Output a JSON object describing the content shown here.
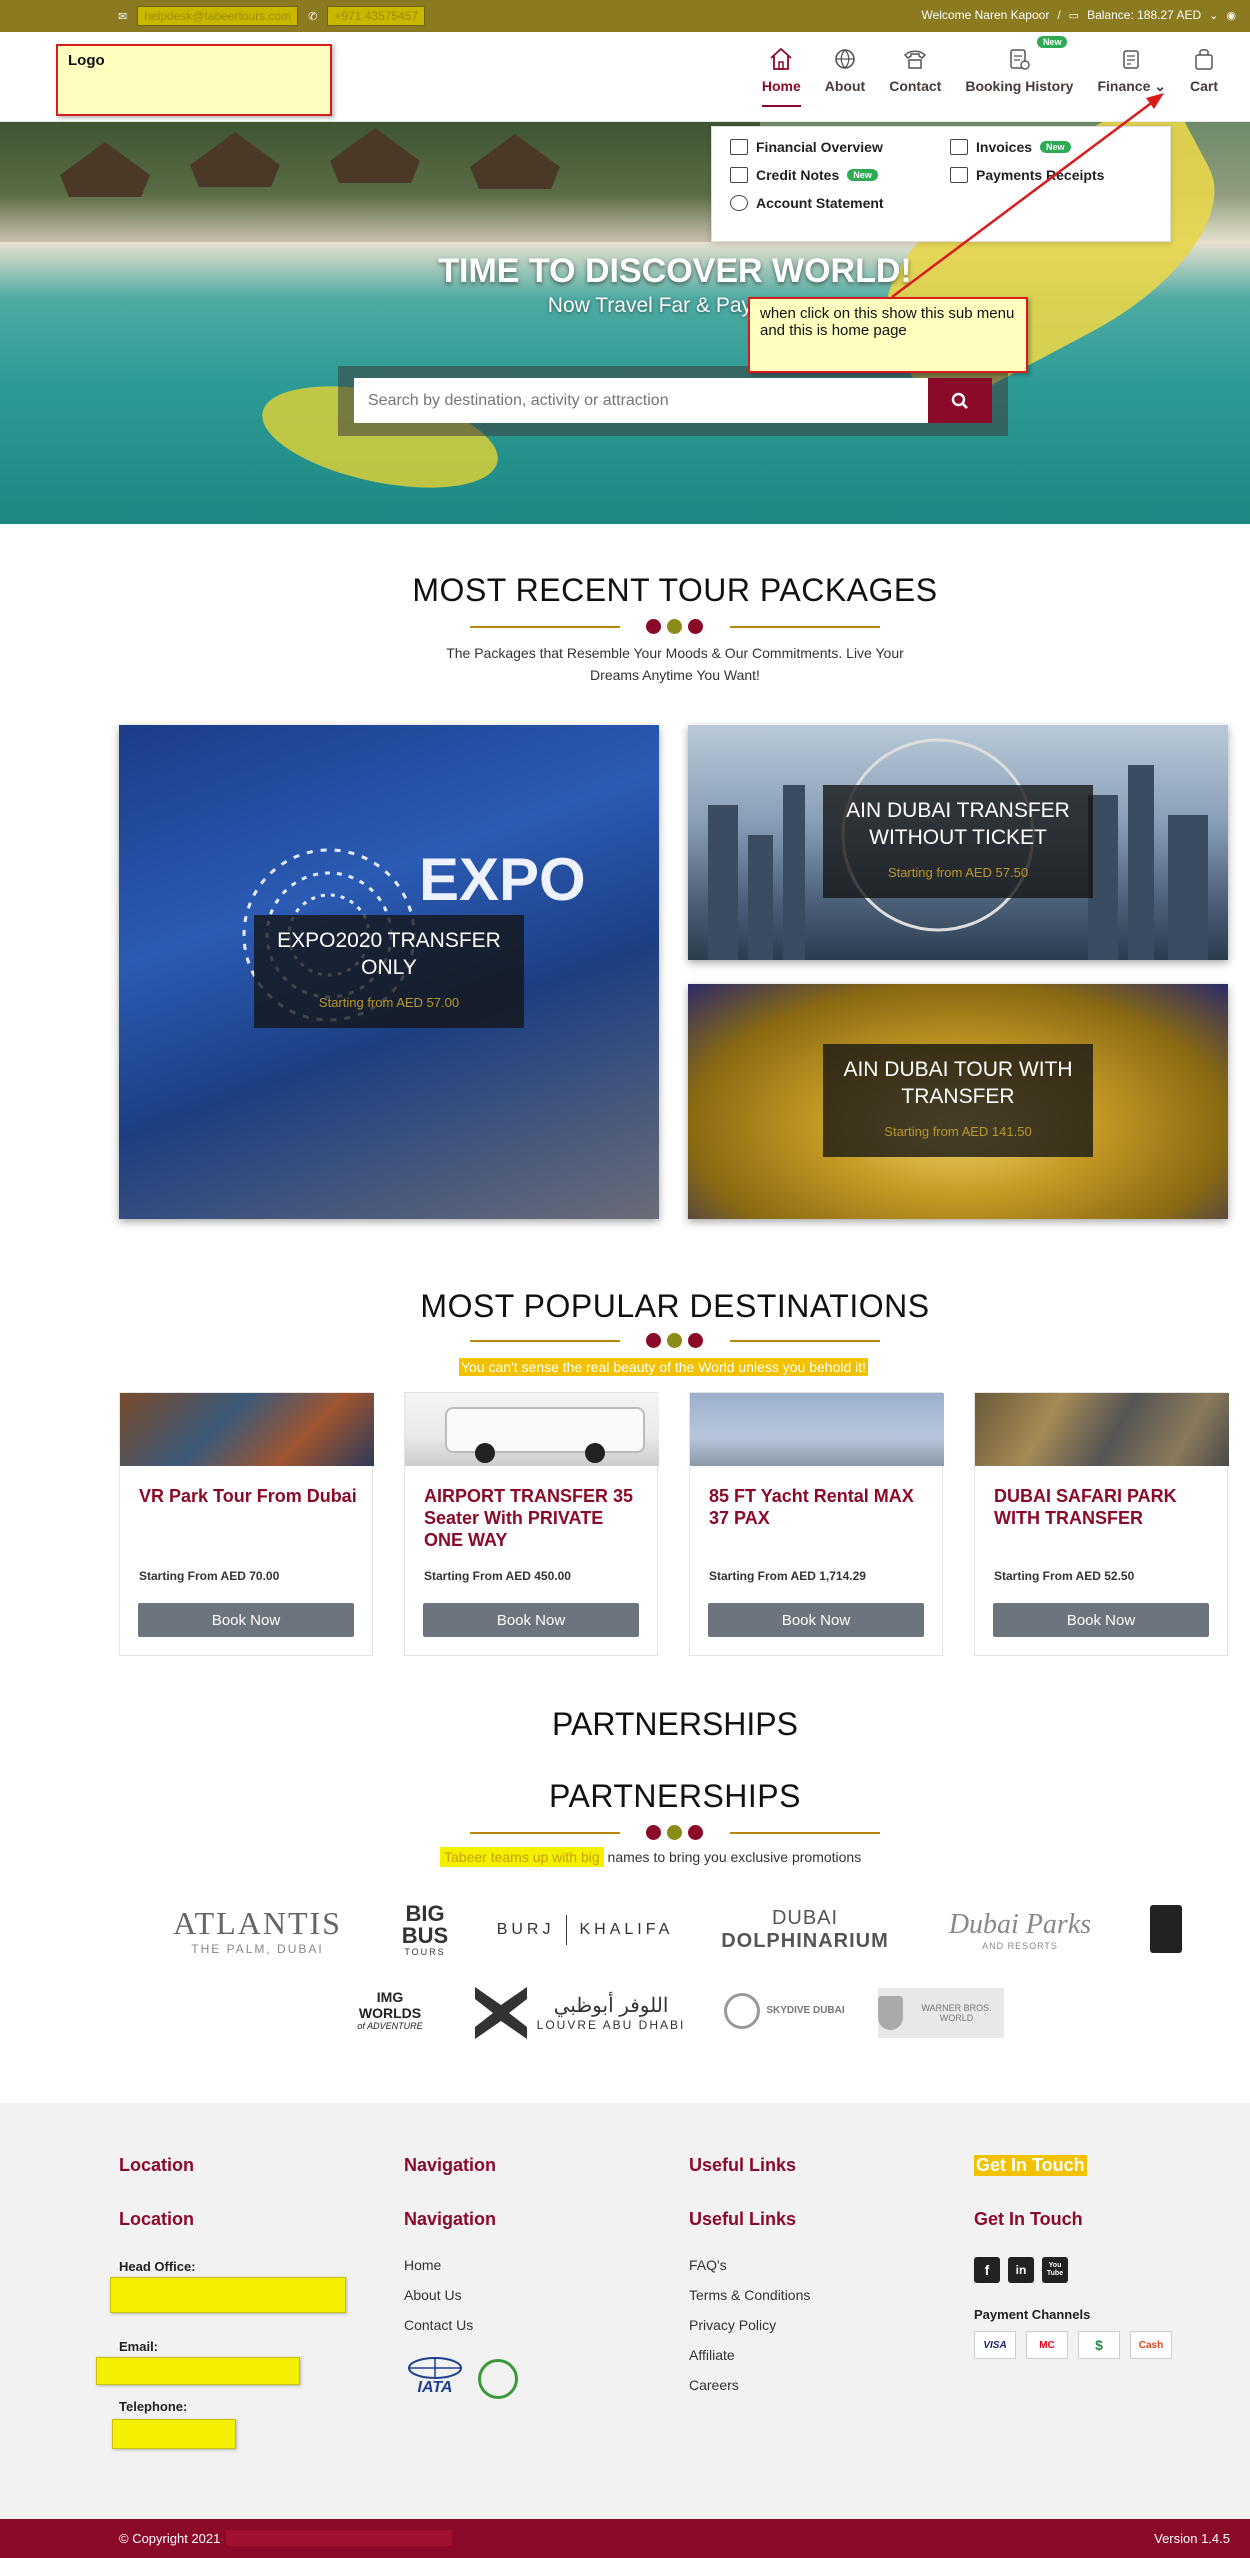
{
  "topbar": {
    "email": "helpdesk@tabeertours.com",
    "phone": "+971 43575457",
    "welcome": "Welcome Naren Kapoor",
    "separator": "/",
    "balance": "Balance: 188.27 AED"
  },
  "logo_note": "Logo",
  "nav": {
    "home": "Home",
    "about": "About",
    "contact": "Contact",
    "booking_history": "Booking History",
    "booking_badge": "New",
    "finance": "Finance",
    "cart": "Cart"
  },
  "finance_menu": {
    "financial_overview": "Financial Overview",
    "invoices": "Invoices",
    "invoices_badge": "New",
    "credit_notes": "Credit Notes",
    "credit_badge": "New",
    "payments_receipts": "Payments Receipts",
    "account_statement": "Account Statement"
  },
  "annotation_note": "when click on this show this sub menu and this is home page",
  "hero": {
    "title": "TIME TO DISCOVER WORLD!",
    "subtitle": "Now Travel Far & Pay Less",
    "search_placeholder": "Search by destination, activity or attraction"
  },
  "packages": {
    "title": "MOST RECENT TOUR PACKAGES",
    "description": "The Packages that Resemble Your Moods & Our Commitments. Live Your Dreams Anytime You Want!",
    "items": [
      {
        "name": "EXPO2020 TRANSFER ONLY",
        "price": "Starting from AED 57.00",
        "image_text": "EXPO"
      },
      {
        "name": "AIN DUBAI TRANSFER WITHOUT TICKET",
        "price": "Starting from AED 57.50"
      },
      {
        "name": "AIN DUBAI TOUR WITH TRANSFER",
        "price": "Starting from AED 141.50"
      }
    ]
  },
  "destinations": {
    "title": "MOST POPULAR DESTINATIONS",
    "description": "You can't sense the real beauty of the World unless you behold it!",
    "items": [
      {
        "name": "VR Park Tour From Dubai",
        "price": "Starting From AED 70.00",
        "button": "Book Now"
      },
      {
        "name": "AIRPORT TRANSFER 35 Seater With PRIVATE ONE WAY",
        "price": "Starting From AED 450.00",
        "button": "Book Now"
      },
      {
        "name": "85 FT Yacht Rental MAX 37 PAX",
        "price": "Starting From AED 1,714.29",
        "button": "Book Now"
      },
      {
        "name": "DUBAI SAFARI PARK WITH TRANSFER",
        "price": "Starting From AED 52.50",
        "button": "Book Now"
      }
    ]
  },
  "partnerships": {
    "title_ghost": "PARTNERSHIPS",
    "title": "PARTNERSHIPS",
    "desc_highlight": "Tabeer teams up with big",
    "desc_rest": " names to bring you exclusive promotions",
    "logos": {
      "atlantis": "ATLANTIS",
      "atlantis_sub": "THE PALM, DUBAI",
      "bigbus": "BIG BUS",
      "bigbus_sub": "TOURS",
      "burj_left": "BURJ",
      "burj_right": "KHALIFA",
      "dolphin_top": "DUBAI",
      "dolphin_bottom": "DOLPHINARIUM",
      "dubai_parks": "Dubai Parks",
      "dubai_parks_sub": "AND RESORTS",
      "img_worlds": "IMG WORLDS",
      "img_worlds_sub": "of ADVENTURE",
      "louvre_ar": "اللوفر أبوظبي",
      "louvre": "LOUVRE ABU DHABI",
      "skydive": "SKYDIVE DUBAI",
      "warner": "WARNER BROS. WORLD"
    }
  },
  "footer": {
    "col1_head_hl": "Location",
    "col2_head_hl": "Navigation",
    "col3_head_hl": "Useful Links",
    "col4_head_hl": "Get In Touch",
    "col1_head": "Location",
    "col2_head": "Navigation",
    "col3_head": "Useful Links",
    "col4_head": "Get In Touch",
    "head_office_label": "Head Office:",
    "email_label": "Email:",
    "telephone_label": "Telephone:",
    "nav_links": [
      "Home",
      "About Us",
      "Contact Us"
    ],
    "useful_links": [
      "FAQ's",
      "Terms & Conditions",
      "Privacy Policy",
      "Affiliate",
      "Careers"
    ],
    "social": [
      "f",
      "in",
      "You Tube"
    ],
    "payment_label": "Payment Channels",
    "payments": [
      "VISA",
      "MC",
      "$",
      "Cash"
    ],
    "iata": "IATA"
  },
  "bottom": {
    "copyright": "© Copyright 2021",
    "version": "Version 1.4.5"
  },
  "colors": {
    "brand": "#8b0a2a",
    "gold": "#8b7a20",
    "accent_dot_2": "#8b8b1a"
  }
}
